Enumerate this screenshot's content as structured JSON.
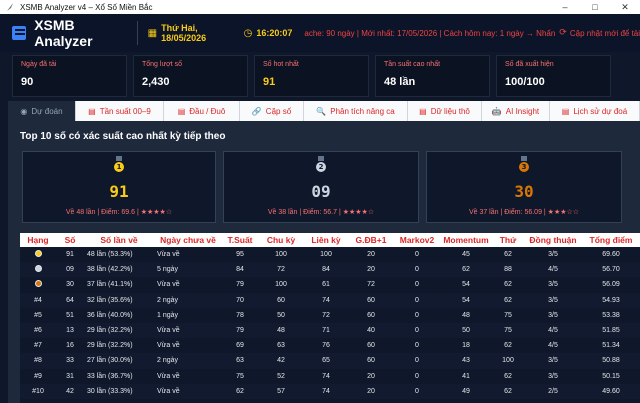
{
  "window": {
    "title": "XSMB Analyzer v4 – Xổ Số Miền Bắc",
    "controls": [
      "–",
      "□",
      "✕"
    ]
  },
  "header": {
    "app_title": "XSMB Analyzer",
    "date": "Thứ Hai, 18/05/2026",
    "time": "16:20:07",
    "status": "ache: 90 ngày  |  Mới nhất: 17/05/2026  |  Cách hôm nay: 1 ngày  →  Nhấn",
    "update_label": "Cập nhật mới để tải",
    "icons": {
      "app": "list-icon",
      "date": "calendar-icon",
      "time": "clock-icon",
      "update": "sync-icon"
    }
  },
  "stats": [
    {
      "label": "Ngày đã tải",
      "value": "90"
    },
    {
      "label": "Tổng lượt số",
      "value": "2,430"
    },
    {
      "label": "Số hot nhất",
      "value": "91"
    },
    {
      "label": "Tần suất cao nhất",
      "value": "48 lần"
    },
    {
      "label": "Số đã xuất hiện",
      "value": "100/100"
    }
  ],
  "tabs": [
    {
      "icon": "◉",
      "label": "Dự đoán"
    },
    {
      "icon": "▤",
      "label": "Tần suất 00–9"
    },
    {
      "icon": "▤",
      "label": "Đầu / Đuô"
    },
    {
      "icon": "🔗",
      "label": "Cặp số"
    },
    {
      "icon": "🔍",
      "label": "Phân tích nâng ca"
    },
    {
      "icon": "▤",
      "label": "Dữ liệu thô"
    },
    {
      "icon": "🤖",
      "label": "AI Insight"
    },
    {
      "icon": "▤",
      "label": "Lịch sử dự đoá"
    }
  ],
  "panel": {
    "title": "Top 10 số có xác suất cao nhất kỳ tiếp theo"
  },
  "top_cards": [
    {
      "number": "91",
      "stats": "Về 48 lần  |  Điểm: 69.6  |  ★★★★☆",
      "color": "#facc15",
      "medal_color": "#facc15",
      "medal_label": "1"
    },
    {
      "number": "09",
      "stats": "Về 38 lần  |  Điểm: 56.7  |  ★★★★☆",
      "color": "#cbd5e1",
      "medal_color": "#cbd5e1",
      "medal_label": "2"
    },
    {
      "number": "30",
      "stats": "Về 37 lần  |  Điểm: 56.09  |  ★★★☆☆",
      "color": "#d97706",
      "medal_color": "#d97706",
      "medal_label": "3"
    }
  ],
  "table": {
    "columns": [
      "Hạng",
      "Số",
      "Số lần về",
      "Ngày chưa về",
      "T.Suất",
      "Chu kỳ",
      "Liên kỳ",
      "G.ĐB+1",
      "Markov2",
      "Momentum",
      "Thứ",
      "Đồng thuận",
      "Tổng điểm"
    ],
    "rows": [
      [
        "medal-gold",
        "91",
        "48 lần (53.3%)",
        "Vừa về",
        "95",
        "100",
        "100",
        "20",
        "0",
        "45",
        "62",
        "3/5",
        "69.60"
      ],
      [
        "medal-silver",
        "09",
        "38 lần (42.2%)",
        "5 ngày",
        "84",
        "72",
        "84",
        "20",
        "0",
        "62",
        "88",
        "4/5",
        "56.70"
      ],
      [
        "medal-bronze",
        "30",
        "37 lần (41.1%)",
        "Vừa về",
        "79",
        "100",
        "61",
        "72",
        "0",
        "54",
        "62",
        "3/5",
        "56.09"
      ],
      [
        "#4",
        "64",
        "32 lần (35.6%)",
        "2 ngày",
        "70",
        "60",
        "74",
        "60",
        "0",
        "54",
        "62",
        "3/5",
        "54.93"
      ],
      [
        "#5",
        "51",
        "36 lần (40.0%)",
        "1 ngày",
        "78",
        "50",
        "72",
        "60",
        "0",
        "48",
        "75",
        "3/5",
        "53.38"
      ],
      [
        "#6",
        "13",
        "29 lần (32.2%)",
        "Vừa về",
        "79",
        "48",
        "71",
        "40",
        "0",
        "50",
        "75",
        "4/5",
        "51.85"
      ],
      [
        "#7",
        "16",
        "29 lần (32.2%)",
        "Vừa về",
        "69",
        "63",
        "76",
        "60",
        "0",
        "18",
        "62",
        "4/5",
        "51.34"
      ],
      [
        "#8",
        "33",
        "27 lần (30.0%)",
        "2 ngày",
        "63",
        "42",
        "65",
        "60",
        "0",
        "43",
        "100",
        "3/5",
        "50.88"
      ],
      [
        "#9",
        "31",
        "33 lần (36.7%)",
        "Vừa về",
        "75",
        "52",
        "74",
        "20",
        "0",
        "41",
        "62",
        "3/5",
        "50.15"
      ],
      [
        "#10",
        "42",
        "30 lần (33.3%)",
        "Vừa về",
        "62",
        "57",
        "74",
        "20",
        "0",
        "49",
        "62",
        "2/5",
        "49.60"
      ]
    ]
  },
  "colors": {
    "accent_red": "#dc2626",
    "gold": "#facc15",
    "silver": "#cbd5e1",
    "bronze": "#d97706"
  }
}
